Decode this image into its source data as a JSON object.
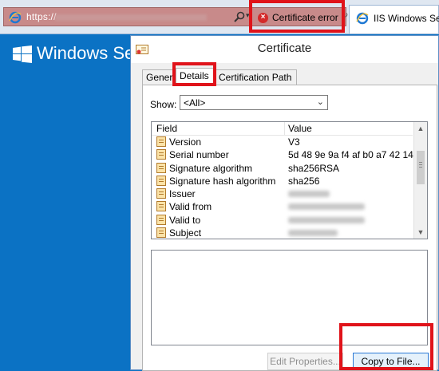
{
  "browser": {
    "address_text": "https://",
    "cert_error_label": "Certificate error",
    "tab_title": "IIS Windows Server"
  },
  "desktop": {
    "brand_text": "Windows Server"
  },
  "dialog": {
    "title": "Certificate",
    "tabs": [
      "General",
      "Details",
      "Certification Path"
    ],
    "active_tab": "Details",
    "show_label": "Show:",
    "show_value": "<All>",
    "columns": [
      "Field",
      "Value"
    ],
    "rows": [
      {
        "field": "Version",
        "value": "V3"
      },
      {
        "field": "Serial number",
        "value": "5d 48 9e 9a f4 af b0 a7 42 14 ..."
      },
      {
        "field": "Signature algorithm",
        "value": "sha256RSA"
      },
      {
        "field": "Signature hash algorithm",
        "value": "sha256"
      },
      {
        "field": "Issuer",
        "value": ""
      },
      {
        "field": "Valid from",
        "value": ""
      },
      {
        "field": "Valid to",
        "value": ""
      },
      {
        "field": "Subject",
        "value": ""
      }
    ],
    "edit_properties_label": "Edit Properties...",
    "copy_to_file_label": "Copy to File..."
  },
  "colors": {
    "desktop_bg": "#0b72c4",
    "highlight_box": "#e0131a",
    "error_icon": "#d42a2a",
    "address_bar_error": "#c88a8a"
  },
  "icons": [
    "ie-icon",
    "search-icon",
    "dropdown-icon",
    "error-icon",
    "refresh-icon",
    "windows-logo-icon",
    "certificate-icon",
    "field-icon"
  ]
}
